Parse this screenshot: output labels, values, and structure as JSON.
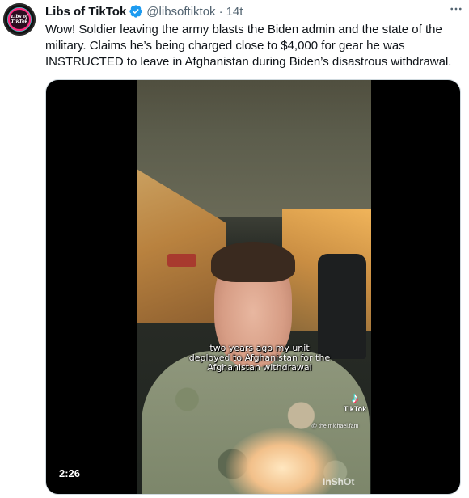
{
  "tweet": {
    "avatar_label": "Libs of TikTok",
    "display_name": "Libs of TikTok",
    "verified": true,
    "handle": "@libsoftiktok",
    "separator": "·",
    "timestamp": "14t",
    "more_icon": "more-horizontal-icon",
    "text": "Wow! Soldier leaving the army blasts the Biden admin and the state of the military. Claims he’s being charged close to $4,000 for gear he was INSTRUCTED to leave in Afghanistan during Biden’s disastrous withdrawal."
  },
  "video": {
    "caption": "two years ago my unit deployed to Afghanistan for the Afghanistan withdrawal",
    "tiktok_brand": "TikTok",
    "tiktok_user": "@ the.michael.fam",
    "watermark": "InShOt",
    "duration": "2:26"
  },
  "colors": {
    "text_primary": "#0f1419",
    "text_secondary": "#536471",
    "verified_blue": "#1d9bf0",
    "media_border": "#cfd9de"
  }
}
